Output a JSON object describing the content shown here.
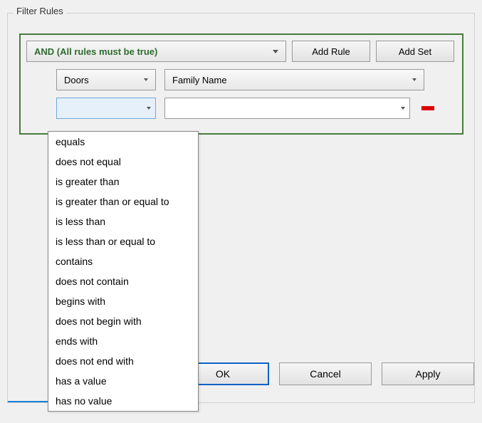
{
  "groupTitle": "Filter Rules",
  "logicSelect": "AND (All rules must be true)",
  "addRule": "Add Rule",
  "addSet": "Add Set",
  "categorySelect": "Doors",
  "parameterSelect": "Family Name",
  "operatorSelect": "",
  "valueSelect": "",
  "dropdown": {
    "options": [
      "equals",
      "does not equal",
      "is greater than",
      "is greater than or equal to",
      "is less than",
      "is less than or equal to",
      "contains",
      "does not contain",
      "begins with",
      "does not begin with",
      "ends with",
      "does not end with",
      "has a value",
      "has no value"
    ]
  },
  "buttons": {
    "ok": "OK",
    "cancel": "Cancel",
    "apply": "Apply"
  }
}
